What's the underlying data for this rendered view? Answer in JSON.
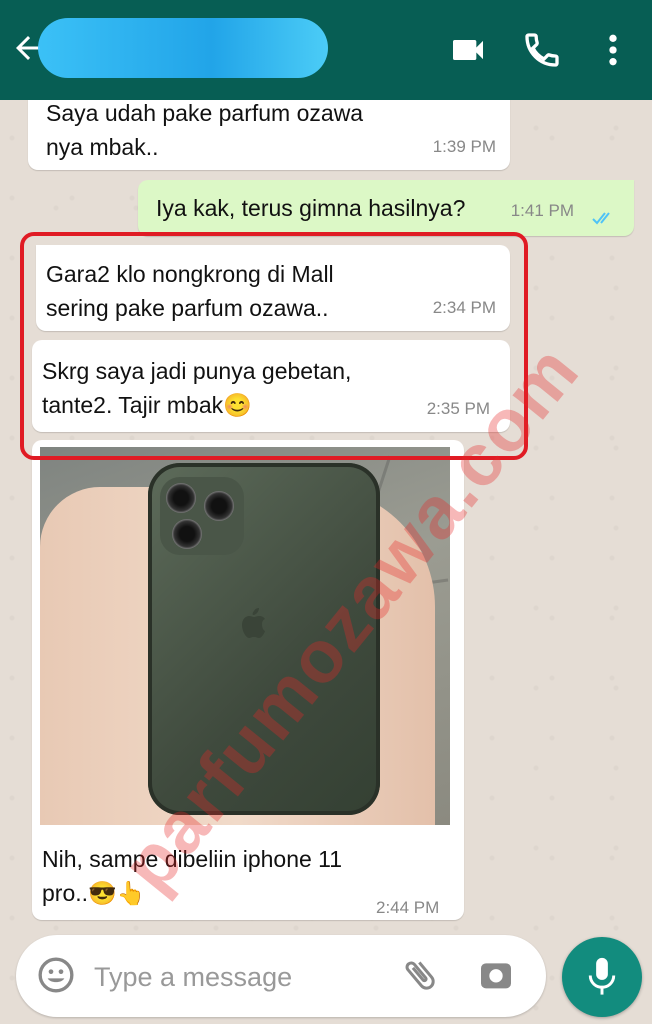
{
  "header": {
    "contact_name": "",
    "icons": [
      "back-arrow-icon",
      "video-call-icon",
      "phone-icon",
      "more-vert-icon"
    ],
    "color": "#075e54"
  },
  "messages": [
    {
      "direction": "incoming",
      "text": "Saya udah pake parfum ozawa\nnya mbak..",
      "time": "1:39 PM"
    },
    {
      "direction": "outgoing",
      "text": "Iya kak, terus gimna hasilnya?",
      "time": "1:41 PM",
      "status": "read"
    },
    {
      "direction": "incoming",
      "text": "Gara2 klo nongkrong di Mall\nsering pake parfum ozawa..",
      "time": "2:34 PM"
    },
    {
      "direction": "incoming",
      "text": "Skrg saya jadi punya gebetan,\ntante2. Tajir mbak😊",
      "time": "2:35 PM"
    },
    {
      "direction": "incoming",
      "type": "image",
      "caption": "Nih, sampe dibeliin iphone 11\npro..😎👆",
      "time": "2:44 PM"
    }
  ],
  "watermark": "parfumozawa.com",
  "input": {
    "placeholder": "Type a message"
  },
  "colors": {
    "incoming": "#ffffff",
    "outgoing": "#dcf8c6",
    "highlight_border": "#e01b24",
    "fab": "#128c7e"
  }
}
